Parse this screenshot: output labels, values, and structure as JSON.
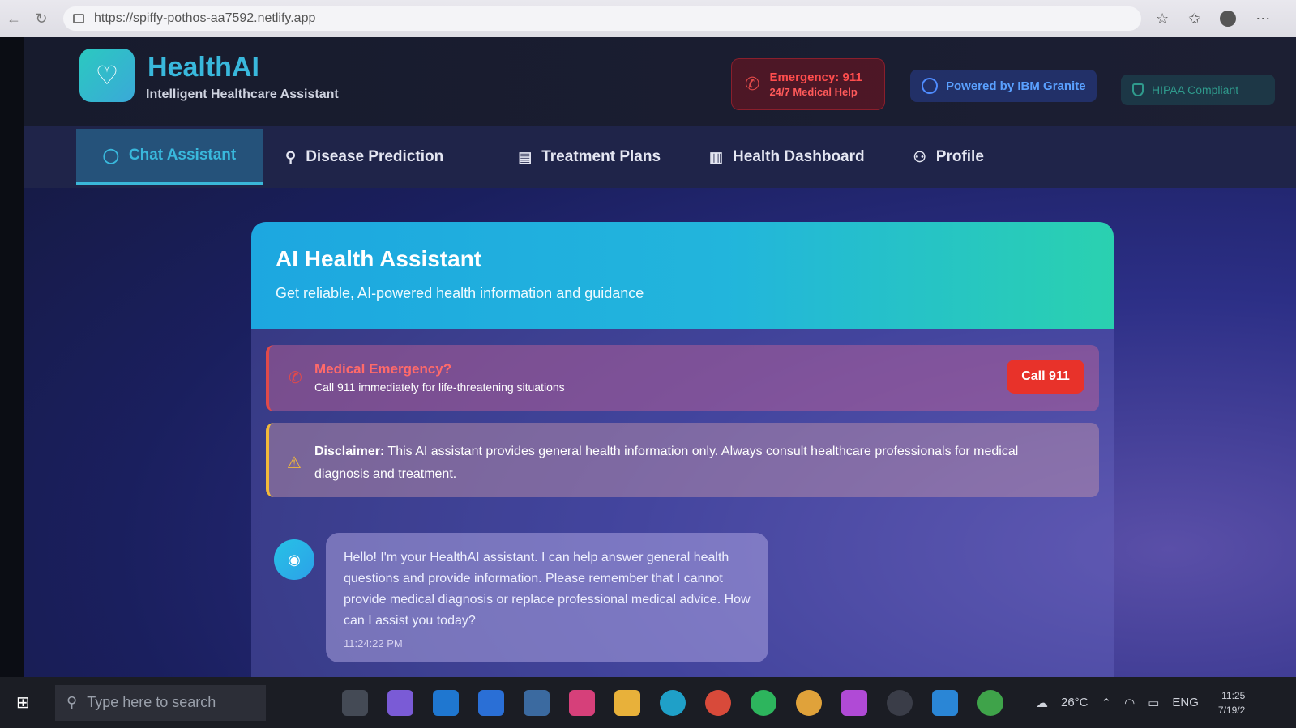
{
  "browser": {
    "url": "https://spiffy-pothos-aa7592.netlify.app"
  },
  "header": {
    "brand_title": "HealthAI",
    "brand_subtitle": "Intelligent Healthcare Assistant",
    "emergency_line1": "Emergency: 911",
    "emergency_line2": "24/7 Medical Help",
    "ibm_label": "Powered by IBM Granite",
    "hipaa_label": "HIPAA Compliant"
  },
  "tabs": [
    {
      "label": "Chat Assistant",
      "icon": "chat-icon",
      "active": true
    },
    {
      "label": "Disease Prediction",
      "icon": "search-icon"
    },
    {
      "label": "Treatment Plans",
      "icon": "document-icon"
    },
    {
      "label": "Health Dashboard",
      "icon": "bar-chart-icon"
    },
    {
      "label": "Profile",
      "icon": "user-icon"
    }
  ],
  "card": {
    "title": "AI Health Assistant",
    "subtitle": "Get reliable, AI-powered health information and guidance",
    "emergency_title": "Medical Emergency?",
    "emergency_desc": "Call 911 immediately for life-threatening situations",
    "call_button": "Call 911",
    "disclaimer_label": "Disclaimer:",
    "disclaimer_text": "This AI assistant provides general health information only. Always consult healthcare professionals for medical diagnosis and treatment."
  },
  "chat": {
    "messages": [
      {
        "text": "Hello! I'm your HealthAI assistant. I can help answer general health questions and provide information. Please remember that I cannot provide medical diagnosis or replace professional medical advice. How can I assist you today?",
        "time": "11:24:22 PM"
      }
    ]
  },
  "taskbar": {
    "search_placeholder": "Type here to search",
    "weather": "26°C",
    "lang": "ENG",
    "clock_time": "11:25",
    "clock_date": "7/19/2"
  },
  "colors": {
    "accent": "#39b8dc",
    "emergency": "#e8322a",
    "warning": "#f2b93a"
  }
}
